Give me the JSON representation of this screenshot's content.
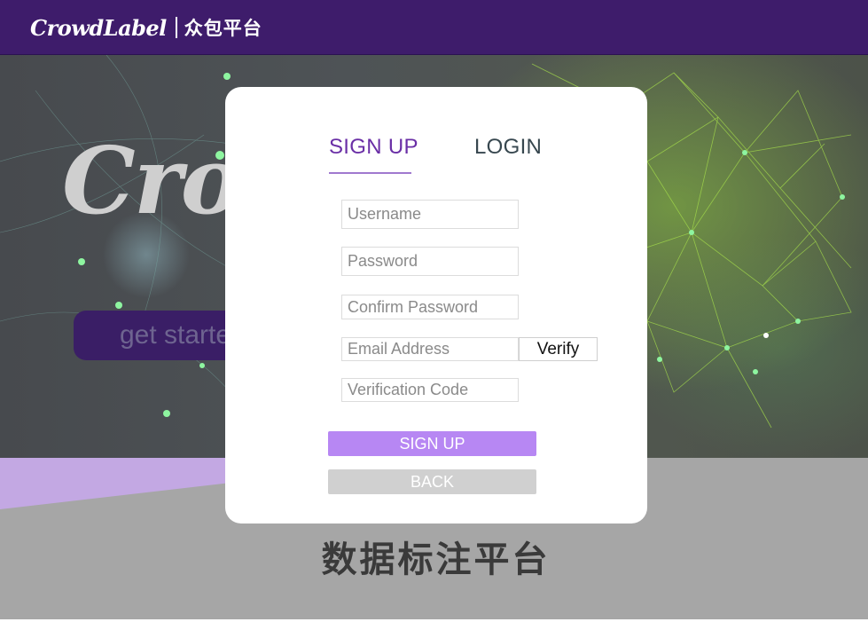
{
  "header": {
    "brand_name": "CrowdLabel",
    "brand_subtitle": "众包平台",
    "background_color": "#3e1c6b"
  },
  "hero": {
    "title": "Crow",
    "cta_label": "get starte"
  },
  "band": {
    "title": "数据标注平台"
  },
  "auth": {
    "tabs": [
      {
        "label": "SIGN UP",
        "active": true
      },
      {
        "label": "LOGIN",
        "active": false
      }
    ],
    "fields": {
      "username": {
        "placeholder": "Username",
        "value": ""
      },
      "password": {
        "placeholder": "Password",
        "value": ""
      },
      "confirm_password": {
        "placeholder": "Confirm Password",
        "value": ""
      },
      "email": {
        "placeholder": "Email Address",
        "value": ""
      },
      "verification_code": {
        "placeholder": "Verification Code",
        "value": ""
      }
    },
    "verify_label": "Verify",
    "signup_label": "SIGN UP",
    "back_label": "BACK",
    "accent_color": "#b787f3",
    "active_tab_color": "#6a2fa6"
  }
}
